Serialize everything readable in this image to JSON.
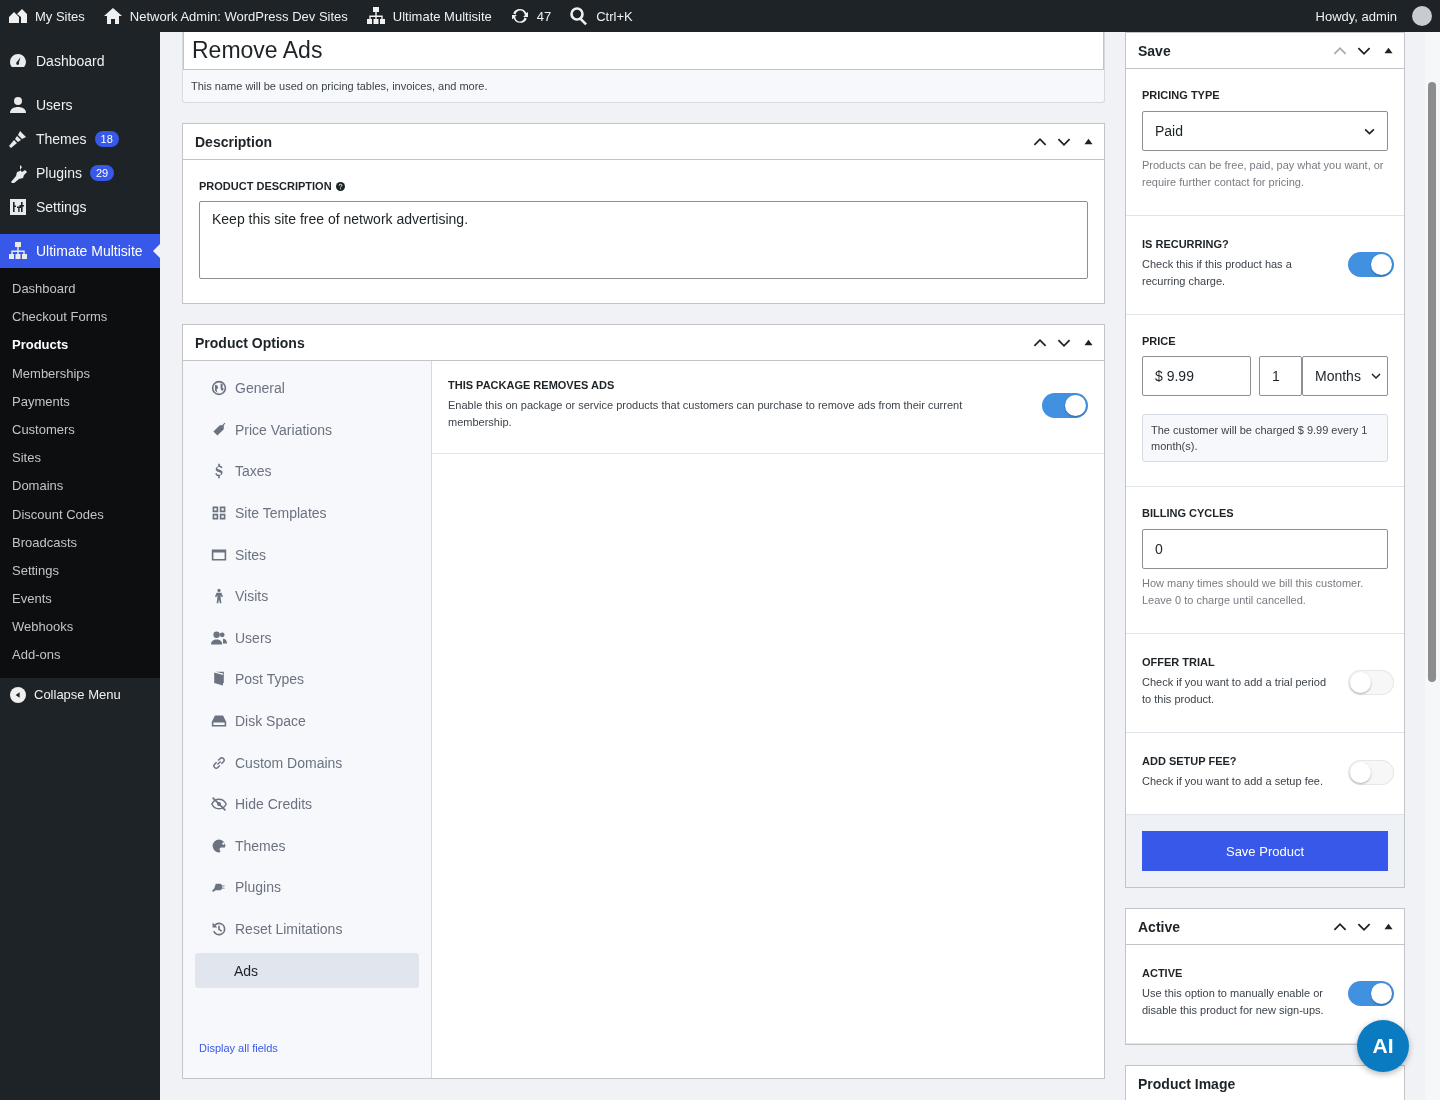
{
  "admin_bar": {
    "items": [
      {
        "label": "My Sites"
      },
      {
        "label": "Network Admin: WordPress Dev Sites"
      },
      {
        "label": "Ultimate Multisite"
      },
      {
        "label": "47"
      },
      {
        "label": "Ctrl+K"
      }
    ],
    "account": "Howdy, admin"
  },
  "sidebar": {
    "items": [
      {
        "label": "Dashboard",
        "selected": false
      },
      {
        "label": "Users",
        "selected": false
      },
      {
        "label": "Themes",
        "badge": "18",
        "selected": false
      },
      {
        "label": "Plugins",
        "badge": "29",
        "selected": false
      },
      {
        "label": "Settings",
        "selected": false
      },
      {
        "label": "Ultimate Multisite",
        "selected": true
      }
    ],
    "submenu": [
      {
        "label": "Dashboard",
        "selected": false
      },
      {
        "label": "Checkout Forms",
        "selected": false
      },
      {
        "label": "Products",
        "selected": true
      },
      {
        "label": "Memberships",
        "selected": false
      },
      {
        "label": "Payments",
        "selected": false
      },
      {
        "label": "Customers",
        "selected": false
      },
      {
        "label": "Sites",
        "selected": false
      },
      {
        "label": "Domains",
        "selected": false
      },
      {
        "label": "Discount Codes",
        "selected": false
      },
      {
        "label": "Broadcasts",
        "selected": false
      },
      {
        "label": "Settings",
        "selected": false
      },
      {
        "label": "Events",
        "selected": false
      },
      {
        "label": "Webhooks",
        "selected": false
      },
      {
        "label": "Add-ons",
        "selected": false
      }
    ],
    "collapse": "Collapse Menu"
  },
  "product_name": {
    "value": "Remove Ads",
    "help": "This name will be used on pricing tables, invoices, and more."
  },
  "description_box": {
    "title": "Description",
    "move_up_disabled": false,
    "label": "PRODUCT DESCRIPTION",
    "value": "Keep this site free of network advertising."
  },
  "options_box": {
    "title": "Product Options",
    "move_up_disabled": false,
    "tabs": [
      {
        "label": "General",
        "selected": false
      },
      {
        "label": "Price Variations",
        "selected": false
      },
      {
        "label": "Taxes",
        "selected": false
      },
      {
        "label": "Site Templates",
        "selected": false
      },
      {
        "label": "Sites",
        "selected": false
      },
      {
        "label": "Visits",
        "selected": false
      },
      {
        "label": "Users",
        "selected": false
      },
      {
        "label": "Post Types",
        "selected": false
      },
      {
        "label": "Disk Space",
        "selected": false
      },
      {
        "label": "Custom Domains",
        "selected": false
      },
      {
        "label": "Hide Credits",
        "selected": false
      },
      {
        "label": "Themes",
        "selected": false
      },
      {
        "label": "Plugins",
        "selected": false
      },
      {
        "label": "Reset Limitations",
        "selected": false
      },
      {
        "label": "Ads",
        "selected": true
      }
    ],
    "display_all": "Display all fields",
    "field": {
      "label": "THIS PACKAGE REMOVES ADS",
      "help": "Enable this on package or service products that customers can purchase to remove ads from their current membership.",
      "on": true
    }
  },
  "save_box": {
    "title": "Save",
    "move_up_disabled": true,
    "pricing_type": {
      "label": "PRICING TYPE",
      "value": "Paid",
      "help": "Products can be free, paid, pay what you want, or require further contact for pricing."
    },
    "is_recurring": {
      "label": "IS RECURRING?",
      "help": "Check this if this product has a recurring charge.",
      "on": true
    },
    "price": {
      "label": "PRICE",
      "amount": "$ 9.99",
      "interval": "1",
      "unit": "Months",
      "note": "The customer will be charged $ 9.99 every 1 month(s)."
    },
    "billing_cycles": {
      "label": "BILLING CYCLES",
      "value": "0",
      "help": "How many times should we bill this customer. Leave 0 to charge until cancelled."
    },
    "offer_trial": {
      "label": "OFFER TRIAL",
      "help": "Check if you want to add a trial period to this product.",
      "on": false
    },
    "setup_fee": {
      "label": "ADD SETUP FEE?",
      "help": "Check if you want to add a setup fee.",
      "on": false
    },
    "button": "Save Product"
  },
  "active_box": {
    "title": "Active",
    "move_up_disabled": false,
    "label": "ACTIVE",
    "help": "Use this option to manually enable or disable this product for new sign-ups.",
    "on": true
  },
  "image_box": {
    "title": "Product Image"
  },
  "assistant_button": {
    "label": "AI"
  }
}
